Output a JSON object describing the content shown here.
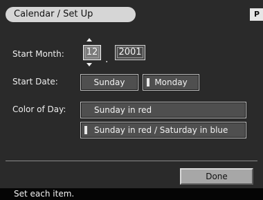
{
  "header": {
    "title": "Calendar / Set Up",
    "mode_badge": "P"
  },
  "start_month": {
    "label": "Start Month:",
    "month_value": "12",
    "separator": ".",
    "year_value": "2001"
  },
  "start_date": {
    "label": "Start Date:",
    "options": [
      "Sunday",
      "Monday"
    ]
  },
  "color_of_day": {
    "label": "Color of Day:",
    "options": [
      "Sunday in red",
      "Sunday in red / Saturday in blue"
    ]
  },
  "footer": {
    "done_label": "Done",
    "status_text": "Set each item."
  }
}
